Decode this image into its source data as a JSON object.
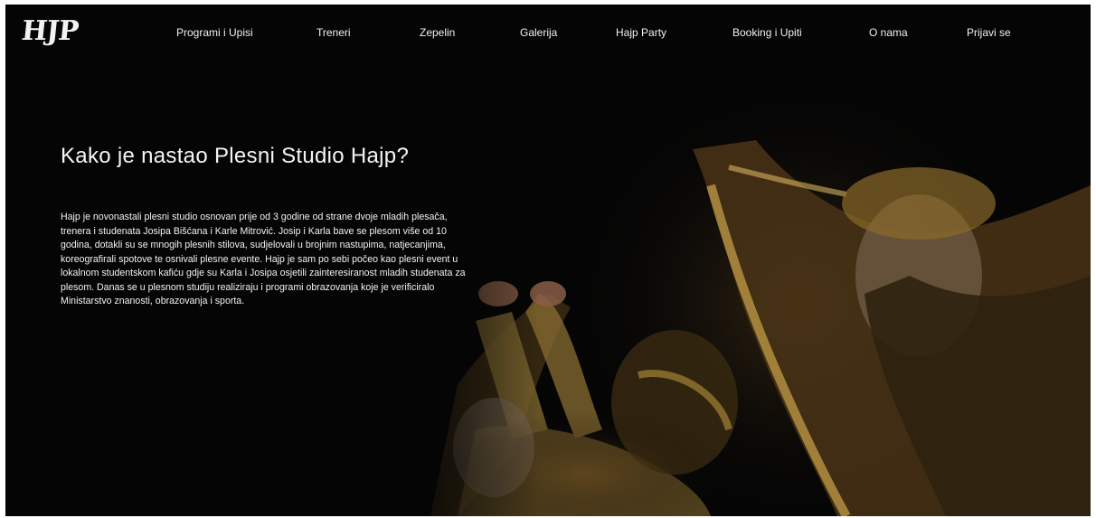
{
  "brand": {
    "logo_text": "HJP"
  },
  "nav": {
    "items": [
      {
        "label": "Programi i Upisi"
      },
      {
        "label": "Treneri"
      },
      {
        "label": "Zepelin"
      },
      {
        "label": "Galerija"
      },
      {
        "label": "Hajp Party"
      },
      {
        "label": "Booking i Upiti"
      },
      {
        "label": "O nama"
      },
      {
        "label": "Prijavi se"
      }
    ]
  },
  "hero": {
    "title": "Kako je nastao Plesni Studio Hajp?",
    "paragraph": "Hajp je novonastali plesni studio osnovan prije od 3 godine od strane dvoje mladih plesača, trenera i studenata Josipa Bišćana i Karle Mitrović. Josip i Karla bave se plesom više od 10 godina, dotakli su se mnogih plesnih stilova, sudjelovali u brojnim nastupima, natjecanjima, koreografirali spotove te osnivali plesne evente. Hajp je sam po sebi počeo kao plesni event u lokalnom studentskom kafiću gdje su Karla i Josipa osjetili zainteresiranost mladih studenata za plesom. Danas se u plesnom studiju realiziraju i programi obrazovanja koje je verificiralo Ministarstvo znanosti, obrazovanja i sporta."
  },
  "colors": {
    "background": "#050505",
    "text": "#f2f2f2",
    "gold": "#b8923a"
  }
}
